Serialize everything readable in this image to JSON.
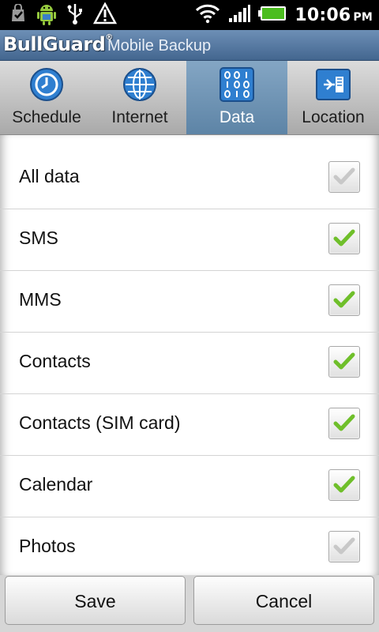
{
  "status_bar": {
    "time": "10:06",
    "ampm": "PM",
    "icons": [
      "checkmark-bag-icon",
      "android-icon",
      "usb-icon",
      "warning-icon",
      "wifi-icon",
      "signal-icon",
      "battery-icon"
    ]
  },
  "title_bar": {
    "brand": "BullGuard",
    "brand_mark": "®",
    "app_name": "Mobile Backup"
  },
  "tabs": [
    {
      "label": "Schedule",
      "icon": "clock-icon",
      "active": false
    },
    {
      "label": "Internet",
      "icon": "globe-icon",
      "active": false
    },
    {
      "label": "Data",
      "icon": "binary-data-icon",
      "active": true
    },
    {
      "label": "Location",
      "icon": "device-location-icon",
      "active": false
    }
  ],
  "data_items": [
    {
      "label": "All data",
      "checked": true,
      "enabled": false
    },
    {
      "label": "SMS",
      "checked": true,
      "enabled": true
    },
    {
      "label": "MMS",
      "checked": true,
      "enabled": true
    },
    {
      "label": "Contacts",
      "checked": true,
      "enabled": true
    },
    {
      "label": "Contacts (SIM card)",
      "checked": true,
      "enabled": true
    },
    {
      "label": "Calendar",
      "checked": true,
      "enabled": true
    },
    {
      "label": "Photos",
      "checked": true,
      "enabled": false
    }
  ],
  "buttons": {
    "save": "Save",
    "cancel": "Cancel"
  },
  "colors": {
    "check_green": "#6fbf2a",
    "check_disabled": "#c8c8c8",
    "title_bar": "#5a7ea8",
    "active_tab": "#6e94b6"
  }
}
